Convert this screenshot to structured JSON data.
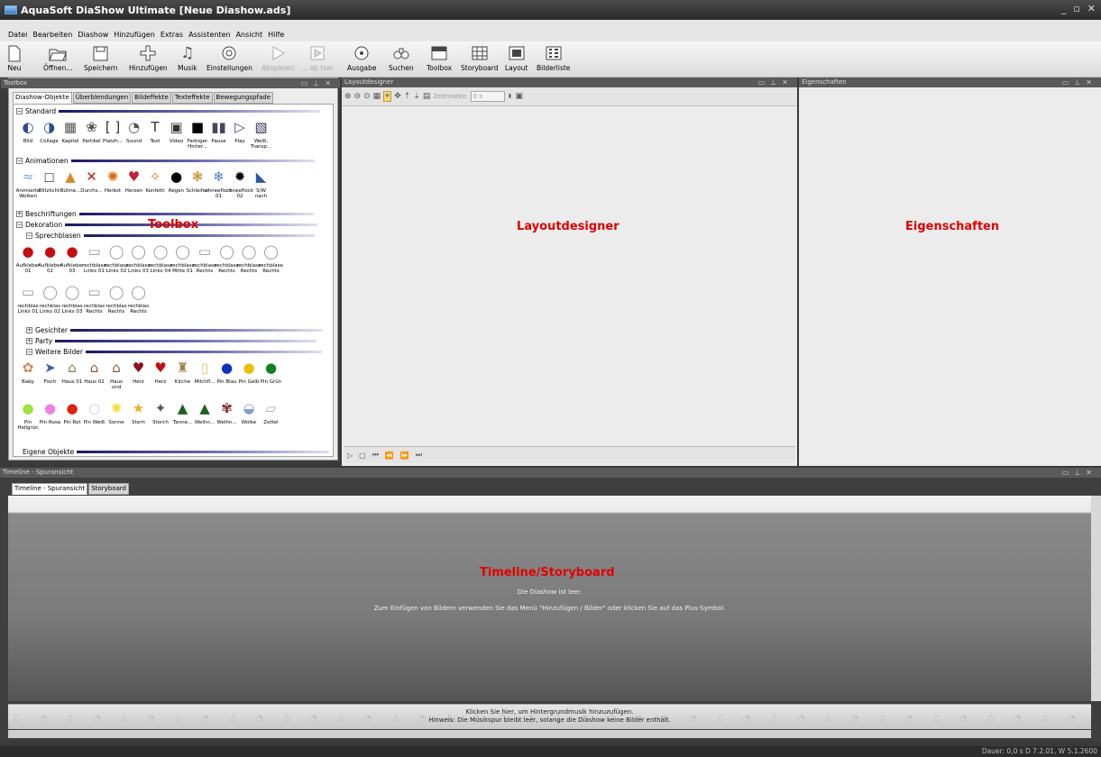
{
  "window": {
    "title": "AquaSoft DiaShow Ultimate [Neue Diashow.ads]"
  },
  "menu": [
    "Datei",
    "Bearbeiten",
    "Diashow",
    "Hinzufügen",
    "Extras",
    "Assistenten",
    "Ansicht",
    "Hilfe"
  ],
  "toolbar": {
    "neu": "Neu",
    "oeffnen": "Öffnen...",
    "speichern": "Speichern",
    "hinzufuegen": "Hinzufügen",
    "musik": "Musik",
    "einstellungen": "Einstellungen",
    "abspielen": "Abspielen",
    "abhier": "... ab hier",
    "ausgabe": "Ausgabe",
    "suchen": "Suchen",
    "toolbox": "Toolbox",
    "storyboard": "Storyboard",
    "layout": "Layout",
    "bilderliste": "Bilderliste"
  },
  "toolbox": {
    "header": "Toolbox",
    "tabs": [
      "Diashow-Objekte",
      "Überblendungen",
      "Bildeffekte",
      "Texteffekte",
      "Bewegungspfade"
    ],
    "overlay_label": "Toolbox",
    "sections": {
      "standard": "Standard",
      "animationen": "Animationen",
      "beschriftungen": "Beschriftungen",
      "dekoration": "Dekoration",
      "sprechblasen": "Sprechblasen",
      "gesichter": "Gesichter",
      "party": "Party",
      "weitere": "Weitere Bilder",
      "eigene": "Eigene Objekte"
    },
    "standard_items": [
      "Bild",
      "Collage",
      "Kapitel",
      "Partikel",
      "Platzh...",
      "Sound",
      "Text",
      "Video",
      "Farbiger Hinter...",
      "Pause",
      "Play",
      "Weiß, Transp..."
    ],
    "anim_items": [
      "Animierte Wolken",
      "Blitzlicht",
      "Bühne...",
      "Durchs...",
      "Herbst",
      "Herzen",
      "Konfetti",
      "Regen",
      "Schleifen",
      "chneeflock 01",
      "chneeflock 02",
      "S/W nach"
    ],
    "sprech_row1": [
      "Aufkleber 01",
      "Aufkleber 02",
      "Aufkleber 03",
      "rechblase Links 01",
      "rechblase Links 02",
      "rechblase Links 03",
      "rechblase Links 04",
      "rechblase Mitte 01",
      "rechblase Rechts",
      "rechblase Rechts",
      "rechblase Rechts",
      "rechblase Rechts"
    ],
    "sprech_row2": [
      "rechblas Links 01",
      "rechblas Links 02",
      "rechblas Links 03",
      "rechblas Rechts",
      "rechblas Rechts",
      "rechblas Rechts"
    ],
    "weitere_row1": [
      "Baby",
      "Fisch",
      "Haus 01",
      "Haus 02",
      "Haus und",
      "Herz",
      "Herz",
      "Kirche",
      "Milchfl...",
      "Pin Blau",
      "Pin Gelb",
      "Pin Grün"
    ],
    "weitere_row2": [
      "Pin Hellgrün",
      "Pin Rosa",
      "Pin Rot",
      "Pin Weiß",
      "Sonne",
      "Stern",
      "Storch",
      "Tanne...",
      "Weihn...",
      "Weihn...",
      "Wolke",
      "Zettel"
    ]
  },
  "layoutdesigner": {
    "header": "Layoutdesigner",
    "label": "Layoutdesigner",
    "zeitmarke_label": "Zeitmarke:",
    "zeitmarke_value": "0 s"
  },
  "properties": {
    "header": "Eigenschaften",
    "label": "Eigenschaften"
  },
  "timeline": {
    "header": "Timeline - Spuransicht",
    "tabs": [
      "Timeline - Spuransicht",
      "Storyboard"
    ],
    "label": "Timeline/Storyboard",
    "empty": "Die Diashow ist leer.",
    "hint": "Zum Einfügen von Bildern verwenden Sie das Menü \"Hinzufügen / Bilder\" oder klicken Sie auf das Plus-Symbol.",
    "music1": "Klicken Sie hier, um Hintergrundmusik hinzuzufügen.",
    "music2": "Hinweis: Die Musikspur bleibt leer, solange die Diashow keine Bilder enthält."
  },
  "status": "Dauer: 0,0 s   D 7.2.01, W 5.1.2600"
}
